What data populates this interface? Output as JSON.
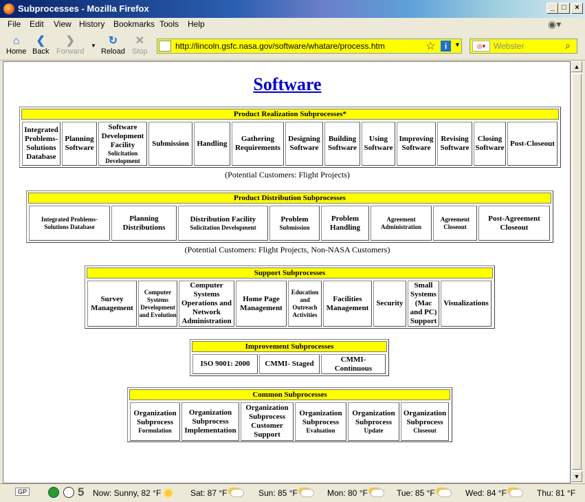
{
  "window": {
    "title": "Subprocesses - Mozilla Firefox"
  },
  "menu": [
    "File",
    "Edit",
    "View",
    "History",
    "Bookmarks",
    "Tools",
    "Help"
  ],
  "toolbar": {
    "home": "Home",
    "back": "Back",
    "forward": "Forward",
    "reload": "Reload",
    "stop": "Stop"
  },
  "address": {
    "url": "http://lincoln.gsfc.nasa.gov/software/whatare/process.htm"
  },
  "search": {
    "placeholder": "Webster"
  },
  "page": {
    "title": "Software",
    "realization": {
      "header": "Product Realization Subprocesses*",
      "caption": "(Potential Customers: Flight Projects)",
      "cells": [
        {
          "t": "Integrated Problems-Solutions Database",
          "s": ""
        },
        {
          "t": "Planning Software",
          "s": ""
        },
        {
          "t": "Software Development Facility",
          "s": "Solicitation Development"
        },
        {
          "t": "Submission",
          "s": ""
        },
        {
          "t": "Handling",
          "s": ""
        },
        {
          "t": "Gathering Requirements",
          "s": ""
        },
        {
          "t": "Designing Software",
          "s": ""
        },
        {
          "t": "Building Software",
          "s": ""
        },
        {
          "t": "Using Software",
          "s": ""
        },
        {
          "t": "Improving Software",
          "s": ""
        },
        {
          "t": "Revising Software",
          "s": ""
        },
        {
          "t": "Closing Software",
          "s": ""
        },
        {
          "t": "Post-Closeout",
          "s": ""
        }
      ]
    },
    "distribution": {
      "header": "Product Distribution Subprocesses",
      "caption": "(Potential Customers: Flight Projects, Non-NASA Customers)",
      "cells": [
        {
          "t": "",
          "s": "Integrated Problems-Solutions Database"
        },
        {
          "t": "Planning Distributions",
          "s": ""
        },
        {
          "t": "Distribution Facility",
          "s": "Solicitation Development"
        },
        {
          "t": "Problem",
          "s": "Submission"
        },
        {
          "t": "Problem Handling",
          "s": ""
        },
        {
          "t": "",
          "s": "Agreement Administration"
        },
        {
          "t": "",
          "s": "Agreement Closeout"
        },
        {
          "t": "Post-Agreement Closeout",
          "s": ""
        }
      ]
    },
    "support": {
      "header": "Support Subprocesses",
      "cells": [
        {
          "t": "Survey Management",
          "s": ""
        },
        {
          "t": "",
          "s": "Computer Systems Development and Evolution"
        },
        {
          "t": "Computer Systems Operations and Network Administration",
          "s": ""
        },
        {
          "t": "Home Page Management",
          "s": ""
        },
        {
          "t": "",
          "s": "Education and Outreach Activities"
        },
        {
          "t": "Facilities Management",
          "s": ""
        },
        {
          "t": "Security",
          "s": ""
        },
        {
          "t": "Small Systems (Mac and PC) Support",
          "s": ""
        },
        {
          "t": "Visualizations",
          "s": ""
        }
      ]
    },
    "improvement": {
      "header": "Improvement Subprocesses",
      "cells": [
        {
          "t": "ISO 9001: 2000",
          "s": ""
        },
        {
          "t": "CMMI- Staged",
          "s": ""
        },
        {
          "t": "CMMI- Continuous",
          "s": ""
        }
      ]
    },
    "common": {
      "header": "Common Subprocesses",
      "cells": [
        {
          "t": "Organization Subprocess",
          "s": "Formulation"
        },
        {
          "t": "Organization Subprocess Implementation",
          "s": ""
        },
        {
          "t": "Organization Subprocess Customer Support",
          "s": ""
        },
        {
          "t": "Organization Subprocess",
          "s": "Evaluation"
        },
        {
          "t": "Organization Subprocess",
          "s": "Update"
        },
        {
          "t": "Organization Subprocess",
          "s": "Closeout"
        }
      ]
    }
  },
  "statusbar": {
    "gp": "GP",
    "count": "5",
    "weather": [
      {
        "label": "Now: Sunny, 82 °F",
        "icon": "sun-icon"
      },
      {
        "label": "Sat: 87 °F",
        "icon": "partly-cloudy-icon"
      },
      {
        "label": "Sun: 85 °F",
        "icon": "partly-cloudy-icon"
      },
      {
        "label": "Mon: 80 °F",
        "icon": "partly-cloudy-icon"
      },
      {
        "label": "Tue: 85 °F",
        "icon": "partly-cloudy-icon"
      },
      {
        "label": "Wed: 84 °F",
        "icon": "partly-cloudy-icon"
      },
      {
        "label": "Thu: 81 °F",
        "icon": "partly-cloudy-icon"
      }
    ]
  }
}
